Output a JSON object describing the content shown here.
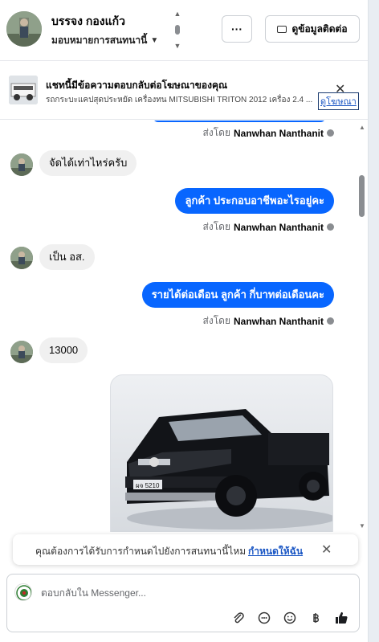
{
  "header": {
    "contact_name": "บรรจง กองแก้ว",
    "assign_label": "มอบหมายการสนทนานี้",
    "more_label": "···",
    "contact_info_label": "ดูข้อมูลติดต่อ"
  },
  "ad_banner": {
    "title": "แชทนี้มีข้อความตอบกลับต่อโฆษณาของคุณ",
    "subtitle": "รถกระบะแคปสุดประหยัด เครื่องทน MITSUBISHI TRITON 2012 เครื่อง 2.4 ...",
    "link_label": "ดูโฆษณา",
    "close_label": "✕"
  },
  "messages": [
    {
      "dir": "in",
      "text": "จัดได้เท่าไหร่ครับ"
    },
    {
      "dir": "out",
      "text": "ลูกค้า ประกอบอาชีพอะไรอยู่คะ",
      "sent_by_prefix": "ส่งโดย",
      "sent_by_name": "Nanwhan Nanthanit"
    },
    {
      "dir": "in",
      "text": "เป็น อส."
    },
    {
      "dir": "out",
      "text": "รายได้ต่อเดือน  ลูกค้า กี่บาทต่อเดือนคะ",
      "sent_by_prefix": "ส่งโดย",
      "sent_by_name": "Nanwhan Nanthanit"
    },
    {
      "dir": "in",
      "text": "13000"
    }
  ],
  "top_sent_by": {
    "prefix": "ส่งโดย",
    "name": "Nanwhan Nanthanit"
  },
  "photo": {
    "plate_text": "ผจ 5210"
  },
  "assign_prompt": {
    "text": "คุณต้องการได้รับการกำหนดไปยังการสนทนานี้ไหม",
    "link_label": "กำหนดให้ฉัน",
    "close_label": "✕"
  },
  "composer": {
    "placeholder": "ตอบกลับใน Messenger..."
  },
  "colors": {
    "accent_blue": "#0866ff",
    "incoming_bubble": "#f0f0f0",
    "link_blue": "#1a56c4"
  }
}
